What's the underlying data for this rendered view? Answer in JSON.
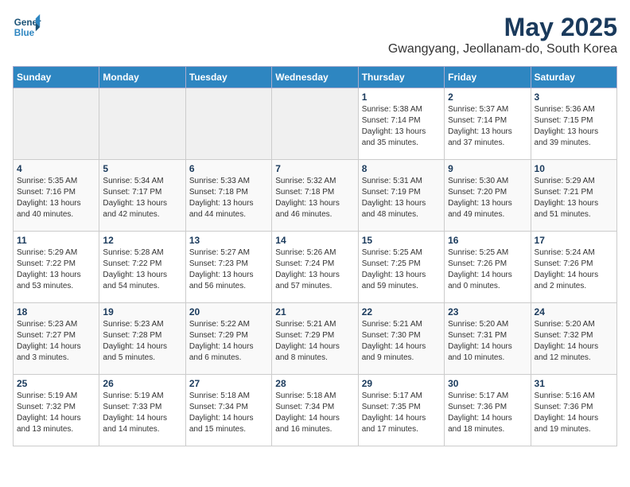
{
  "header": {
    "logo_line1": "General",
    "logo_line2": "Blue",
    "month": "May 2025",
    "location": "Gwangyang, Jeollanam-do, South Korea"
  },
  "days_of_week": [
    "Sunday",
    "Monday",
    "Tuesday",
    "Wednesday",
    "Thursday",
    "Friday",
    "Saturday"
  ],
  "weeks": [
    [
      {
        "day": "",
        "empty": true
      },
      {
        "day": "",
        "empty": true
      },
      {
        "day": "",
        "empty": true
      },
      {
        "day": "",
        "empty": true
      },
      {
        "day": "1",
        "sunrise": "5:38 AM",
        "sunset": "7:14 PM",
        "daylight": "13 hours and 35 minutes."
      },
      {
        "day": "2",
        "sunrise": "5:37 AM",
        "sunset": "7:14 PM",
        "daylight": "13 hours and 37 minutes."
      },
      {
        "day": "3",
        "sunrise": "5:36 AM",
        "sunset": "7:15 PM",
        "daylight": "13 hours and 39 minutes."
      }
    ],
    [
      {
        "day": "4",
        "sunrise": "5:35 AM",
        "sunset": "7:16 PM",
        "daylight": "13 hours and 40 minutes."
      },
      {
        "day": "5",
        "sunrise": "5:34 AM",
        "sunset": "7:17 PM",
        "daylight": "13 hours and 42 minutes."
      },
      {
        "day": "6",
        "sunrise": "5:33 AM",
        "sunset": "7:18 PM",
        "daylight": "13 hours and 44 minutes."
      },
      {
        "day": "7",
        "sunrise": "5:32 AM",
        "sunset": "7:18 PM",
        "daylight": "13 hours and 46 minutes."
      },
      {
        "day": "8",
        "sunrise": "5:31 AM",
        "sunset": "7:19 PM",
        "daylight": "13 hours and 48 minutes."
      },
      {
        "day": "9",
        "sunrise": "5:30 AM",
        "sunset": "7:20 PM",
        "daylight": "13 hours and 49 minutes."
      },
      {
        "day": "10",
        "sunrise": "5:29 AM",
        "sunset": "7:21 PM",
        "daylight": "13 hours and 51 minutes."
      }
    ],
    [
      {
        "day": "11",
        "sunrise": "5:29 AM",
        "sunset": "7:22 PM",
        "daylight": "13 hours and 53 minutes."
      },
      {
        "day": "12",
        "sunrise": "5:28 AM",
        "sunset": "7:22 PM",
        "daylight": "13 hours and 54 minutes."
      },
      {
        "day": "13",
        "sunrise": "5:27 AM",
        "sunset": "7:23 PM",
        "daylight": "13 hours and 56 minutes."
      },
      {
        "day": "14",
        "sunrise": "5:26 AM",
        "sunset": "7:24 PM",
        "daylight": "13 hours and 57 minutes."
      },
      {
        "day": "15",
        "sunrise": "5:25 AM",
        "sunset": "7:25 PM",
        "daylight": "13 hours and 59 minutes."
      },
      {
        "day": "16",
        "sunrise": "5:25 AM",
        "sunset": "7:26 PM",
        "daylight": "14 hours and 0 minutes."
      },
      {
        "day": "17",
        "sunrise": "5:24 AM",
        "sunset": "7:26 PM",
        "daylight": "14 hours and 2 minutes."
      }
    ],
    [
      {
        "day": "18",
        "sunrise": "5:23 AM",
        "sunset": "7:27 PM",
        "daylight": "14 hours and 3 minutes."
      },
      {
        "day": "19",
        "sunrise": "5:23 AM",
        "sunset": "7:28 PM",
        "daylight": "14 hours and 5 minutes."
      },
      {
        "day": "20",
        "sunrise": "5:22 AM",
        "sunset": "7:29 PM",
        "daylight": "14 hours and 6 minutes."
      },
      {
        "day": "21",
        "sunrise": "5:21 AM",
        "sunset": "7:29 PM",
        "daylight": "14 hours and 8 minutes."
      },
      {
        "day": "22",
        "sunrise": "5:21 AM",
        "sunset": "7:30 PM",
        "daylight": "14 hours and 9 minutes."
      },
      {
        "day": "23",
        "sunrise": "5:20 AM",
        "sunset": "7:31 PM",
        "daylight": "14 hours and 10 minutes."
      },
      {
        "day": "24",
        "sunrise": "5:20 AM",
        "sunset": "7:32 PM",
        "daylight": "14 hours and 12 minutes."
      }
    ],
    [
      {
        "day": "25",
        "sunrise": "5:19 AM",
        "sunset": "7:32 PM",
        "daylight": "14 hours and 13 minutes."
      },
      {
        "day": "26",
        "sunrise": "5:19 AM",
        "sunset": "7:33 PM",
        "daylight": "14 hours and 14 minutes."
      },
      {
        "day": "27",
        "sunrise": "5:18 AM",
        "sunset": "7:34 PM",
        "daylight": "14 hours and 15 minutes."
      },
      {
        "day": "28",
        "sunrise": "5:18 AM",
        "sunset": "7:34 PM",
        "daylight": "14 hours and 16 minutes."
      },
      {
        "day": "29",
        "sunrise": "5:17 AM",
        "sunset": "7:35 PM",
        "daylight": "14 hours and 17 minutes."
      },
      {
        "day": "30",
        "sunrise": "5:17 AM",
        "sunset": "7:36 PM",
        "daylight": "14 hours and 18 minutes."
      },
      {
        "day": "31",
        "sunrise": "5:16 AM",
        "sunset": "7:36 PM",
        "daylight": "14 hours and 19 minutes."
      }
    ]
  ],
  "labels": {
    "sunrise": "Sunrise:",
    "sunset": "Sunset:",
    "daylight": "Daylight:"
  }
}
